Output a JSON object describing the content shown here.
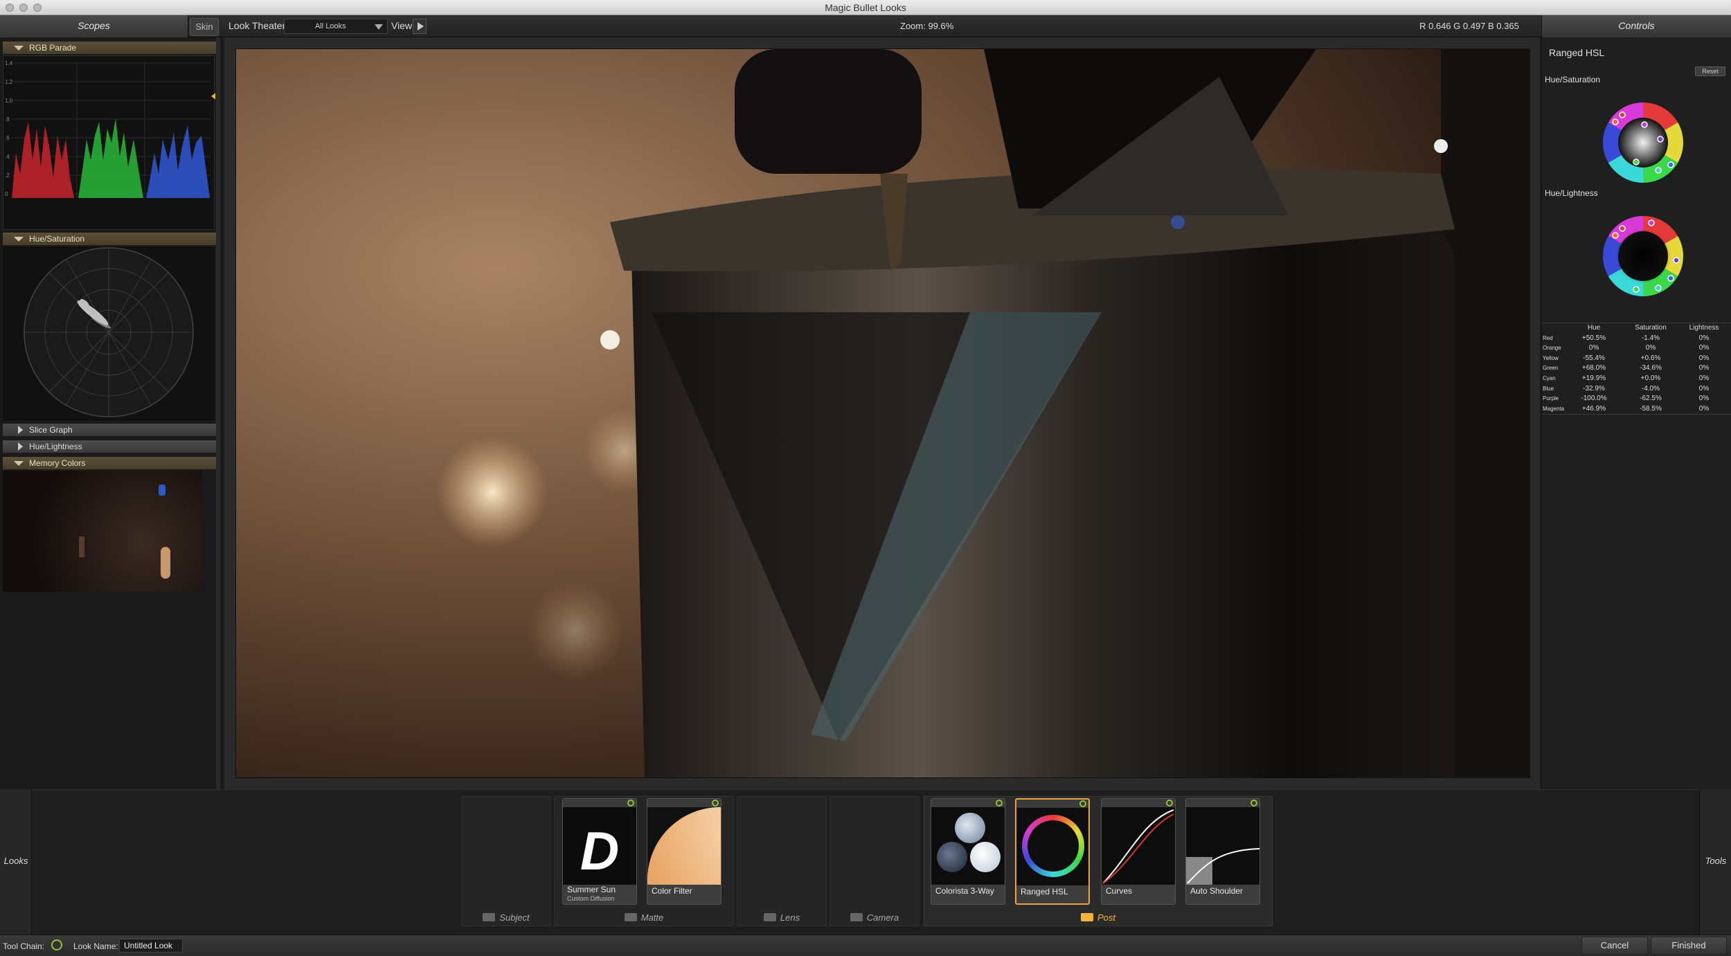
{
  "window": {
    "title": "Magic Bullet Looks"
  },
  "topbar": {
    "scopes_tab": "Scopes",
    "skin_tab": "Skin",
    "look_theater_label": "Look Theater",
    "looks_select_value": "All Looks",
    "view_label": "View",
    "zoom_text": "Zoom:  99.6%",
    "rgb_readout": "R 0.646   G 0.497   B 0.365",
    "controls_tab": "Controls"
  },
  "scopes": {
    "rgb_parade": {
      "label": "RGB Parade",
      "scale": [
        "1.4",
        "1.2",
        "1.0",
        ".8",
        ".6",
        ".4",
        ".2",
        "0"
      ]
    },
    "hue_saturation": {
      "label": "Hue/Saturation"
    },
    "slice_graph": {
      "label": "Slice Graph"
    },
    "hue_lightness": {
      "label": "Hue/Lightness"
    },
    "memory_colors": {
      "label": "Memory Colors"
    }
  },
  "controls": {
    "title": "Ranged HSL",
    "reset_label": "Reset",
    "hue_saturation_label": "Hue/Saturation",
    "hue_lightness_label": "Hue/Lightness",
    "table": {
      "headers": [
        "Hue",
        "Saturation",
        "Lightness"
      ],
      "rows": [
        {
          "name": "Red",
          "hue": "+50.5%",
          "sat": "-1.4%",
          "light": "0%"
        },
        {
          "name": "Orange",
          "hue": "0%",
          "sat": "0%",
          "light": "0%"
        },
        {
          "name": "Yellow",
          "hue": "-55.4%",
          "sat": "+0.6%",
          "light": "0%"
        },
        {
          "name": "Green",
          "hue": "+68.0%",
          "sat": "-34.6%",
          "light": "0%"
        },
        {
          "name": "Cyan",
          "hue": "+19.9%",
          "sat": "+0.0%",
          "light": "0%"
        },
        {
          "name": "Blue",
          "hue": "-32.9%",
          "sat": "-4.0%",
          "light": "0%"
        },
        {
          "name": "Purple",
          "hue": "-100.0%",
          "sat": "-62.5%",
          "light": "0%"
        },
        {
          "name": "Magenta",
          "hue": "+46.9%",
          "sat": "-58.5%",
          "light": "0%"
        }
      ]
    }
  },
  "toolchain": {
    "side_left": "Looks",
    "side_right": "Tools",
    "stages": {
      "subject": "Subject",
      "matte": "Matte",
      "lens": "Lens",
      "camera": "Camera",
      "post": "Post"
    },
    "tools": {
      "summer_sun": {
        "label": "Summer Sun",
        "sub": "Custom Diffusion",
        "glyph": "D"
      },
      "color_filter": {
        "label": "Color Filter"
      },
      "colorista": {
        "label": "Colorista 3-Way"
      },
      "ranged_hsl": {
        "label": "Ranged HSL"
      },
      "curves": {
        "label": "Curves"
      },
      "auto_shoulder": {
        "label": "Auto Shoulder"
      }
    }
  },
  "statusbar": {
    "tool_chain_label": "Tool Chain:",
    "look_name_label": "Look Name:",
    "look_name_value": "Untitled Look",
    "cancel_label": "Cancel",
    "finished_label": "Finished"
  },
  "colors": {
    "accent": "#f4b33a",
    "power": "#8fc33a",
    "section_header": "#5b5039"
  }
}
